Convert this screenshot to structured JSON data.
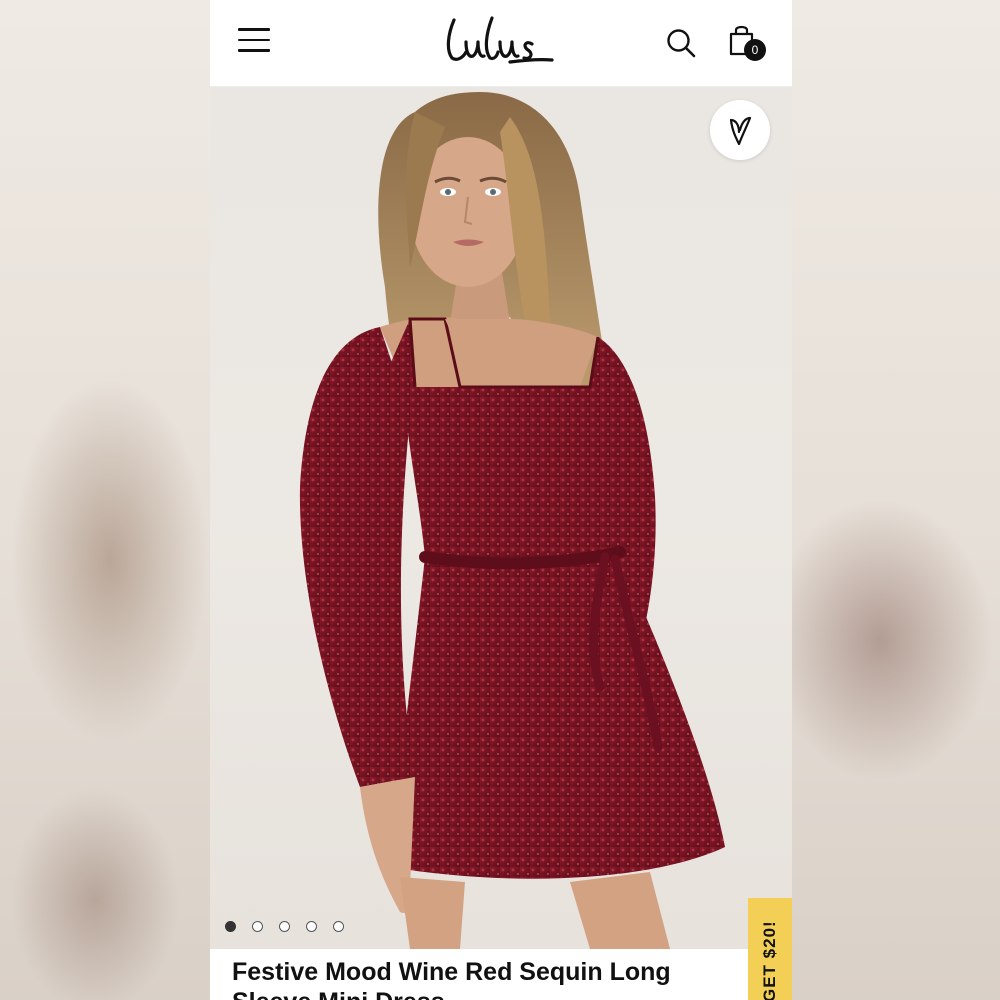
{
  "header": {
    "logo_text": "Lulus",
    "menu_icon": "hamburger-menu-icon",
    "search_icon": "search-icon",
    "cart_icon": "shopping-bag-icon",
    "cart_count": "0"
  },
  "product": {
    "title": "Festive Mood Wine Red Sequin Long Sleeve Mini Dress",
    "image_colors": {
      "dress": "#7a1220",
      "background": "#eae6e1"
    },
    "wishlist_icon": "heart-icon",
    "carousel": {
      "total_slides": 5,
      "active_index": 0
    }
  },
  "promo": {
    "label": "GET $20!",
    "color": "#f4cf55"
  }
}
